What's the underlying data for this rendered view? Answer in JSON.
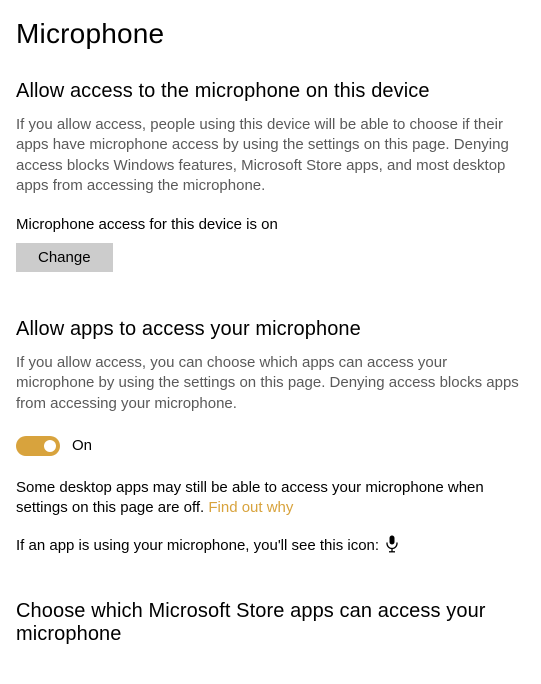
{
  "page_title": "Microphone",
  "section_device": {
    "title": "Allow access to the microphone on this device",
    "body": "If you allow access, people using this device will be able to choose if their apps have microphone access by using the settings on this page. Denying access blocks Windows features, Microsoft Store apps, and most desktop apps from accessing the microphone.",
    "status": "Microphone access for this device is on",
    "button": "Change"
  },
  "section_apps": {
    "title": "Allow apps to access your microphone",
    "body": "If you allow access, you can choose which apps can access your microphone by using the settings on this page. Denying access blocks apps from accessing your microphone.",
    "toggle_state": "On",
    "note_prefix": "Some desktop apps may still be able to access your microphone when settings on this page are off. ",
    "note_link": "Find out why",
    "icon_line": "If an app is using your microphone, you'll see this icon:"
  },
  "section_choose": {
    "title": "Choose which Microsoft Store apps can access your microphone"
  },
  "colors": {
    "accent": "#d8a33d",
    "muted_text": "#5a5a5a",
    "button_bg": "#cccccc"
  }
}
